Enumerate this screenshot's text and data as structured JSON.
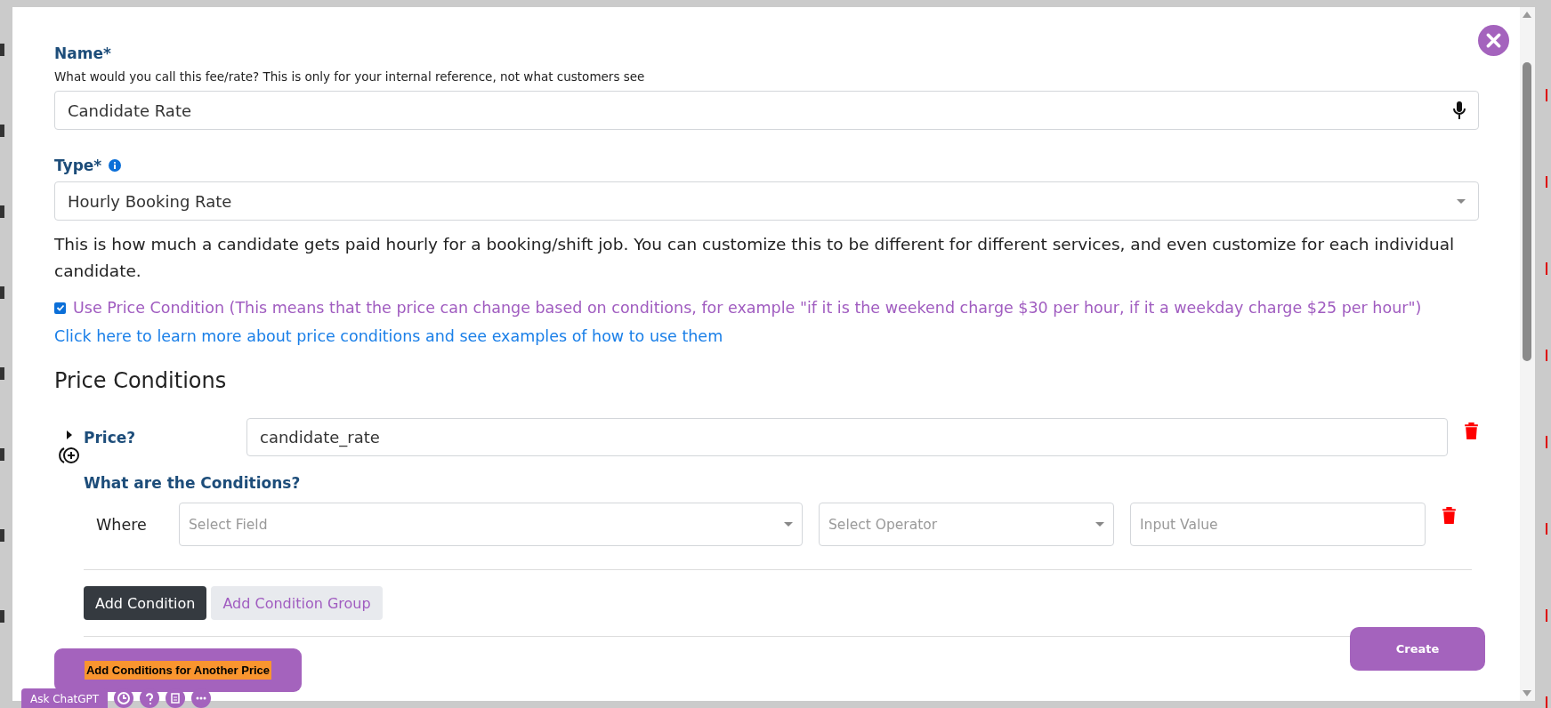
{
  "modal": {
    "name_field": {
      "label": "Name*",
      "hint": "What would you call this fee/rate? This is only for your internal reference, not what customers see",
      "value": "Candidate Rate"
    },
    "type_field": {
      "label": "Type*",
      "value": "Hourly Booking Rate"
    },
    "type_description": "This is how much a candidate gets paid hourly for a booking/shift job. You can customize this to be different for different services, and even customize for each individual candidate.",
    "use_price_condition": {
      "label": "Use Price Condition (This means that the price can change based on conditions, for example \"if it is the weekend charge $30 per hour, if it a weekday charge $25 per hour\")",
      "checked": true
    },
    "learn_more_link": "Click here to learn more about price conditions and see examples of how to use them",
    "section_title": "Price Conditions",
    "price_blocks": [
      {
        "expanded": false,
        "price_label": "Price?",
        "price_value": "candidate_rate",
        "conditions_title": "What are the Conditions?",
        "conditions": [
          {
            "where_label": "Where",
            "field_placeholder": "Select Field",
            "operator_placeholder": "Select Operator",
            "value_placeholder": "Input Value"
          }
        ],
        "buttons": [
          {
            "label": "Add Condition",
            "kind": "dark"
          },
          {
            "label": "Add Condition Group",
            "kind": "light"
          }
        ]
      }
    ],
    "add_price_button": "Add Conditions for Another Price",
    "create_button": "Create"
  },
  "dock": {
    "ask_button": "Ask ChatGPT",
    "round_buttons": [
      {
        "kind": "clock"
      },
      {
        "kind": "help"
      },
      {
        "kind": "notes"
      },
      {
        "kind": "more"
      }
    ]
  }
}
